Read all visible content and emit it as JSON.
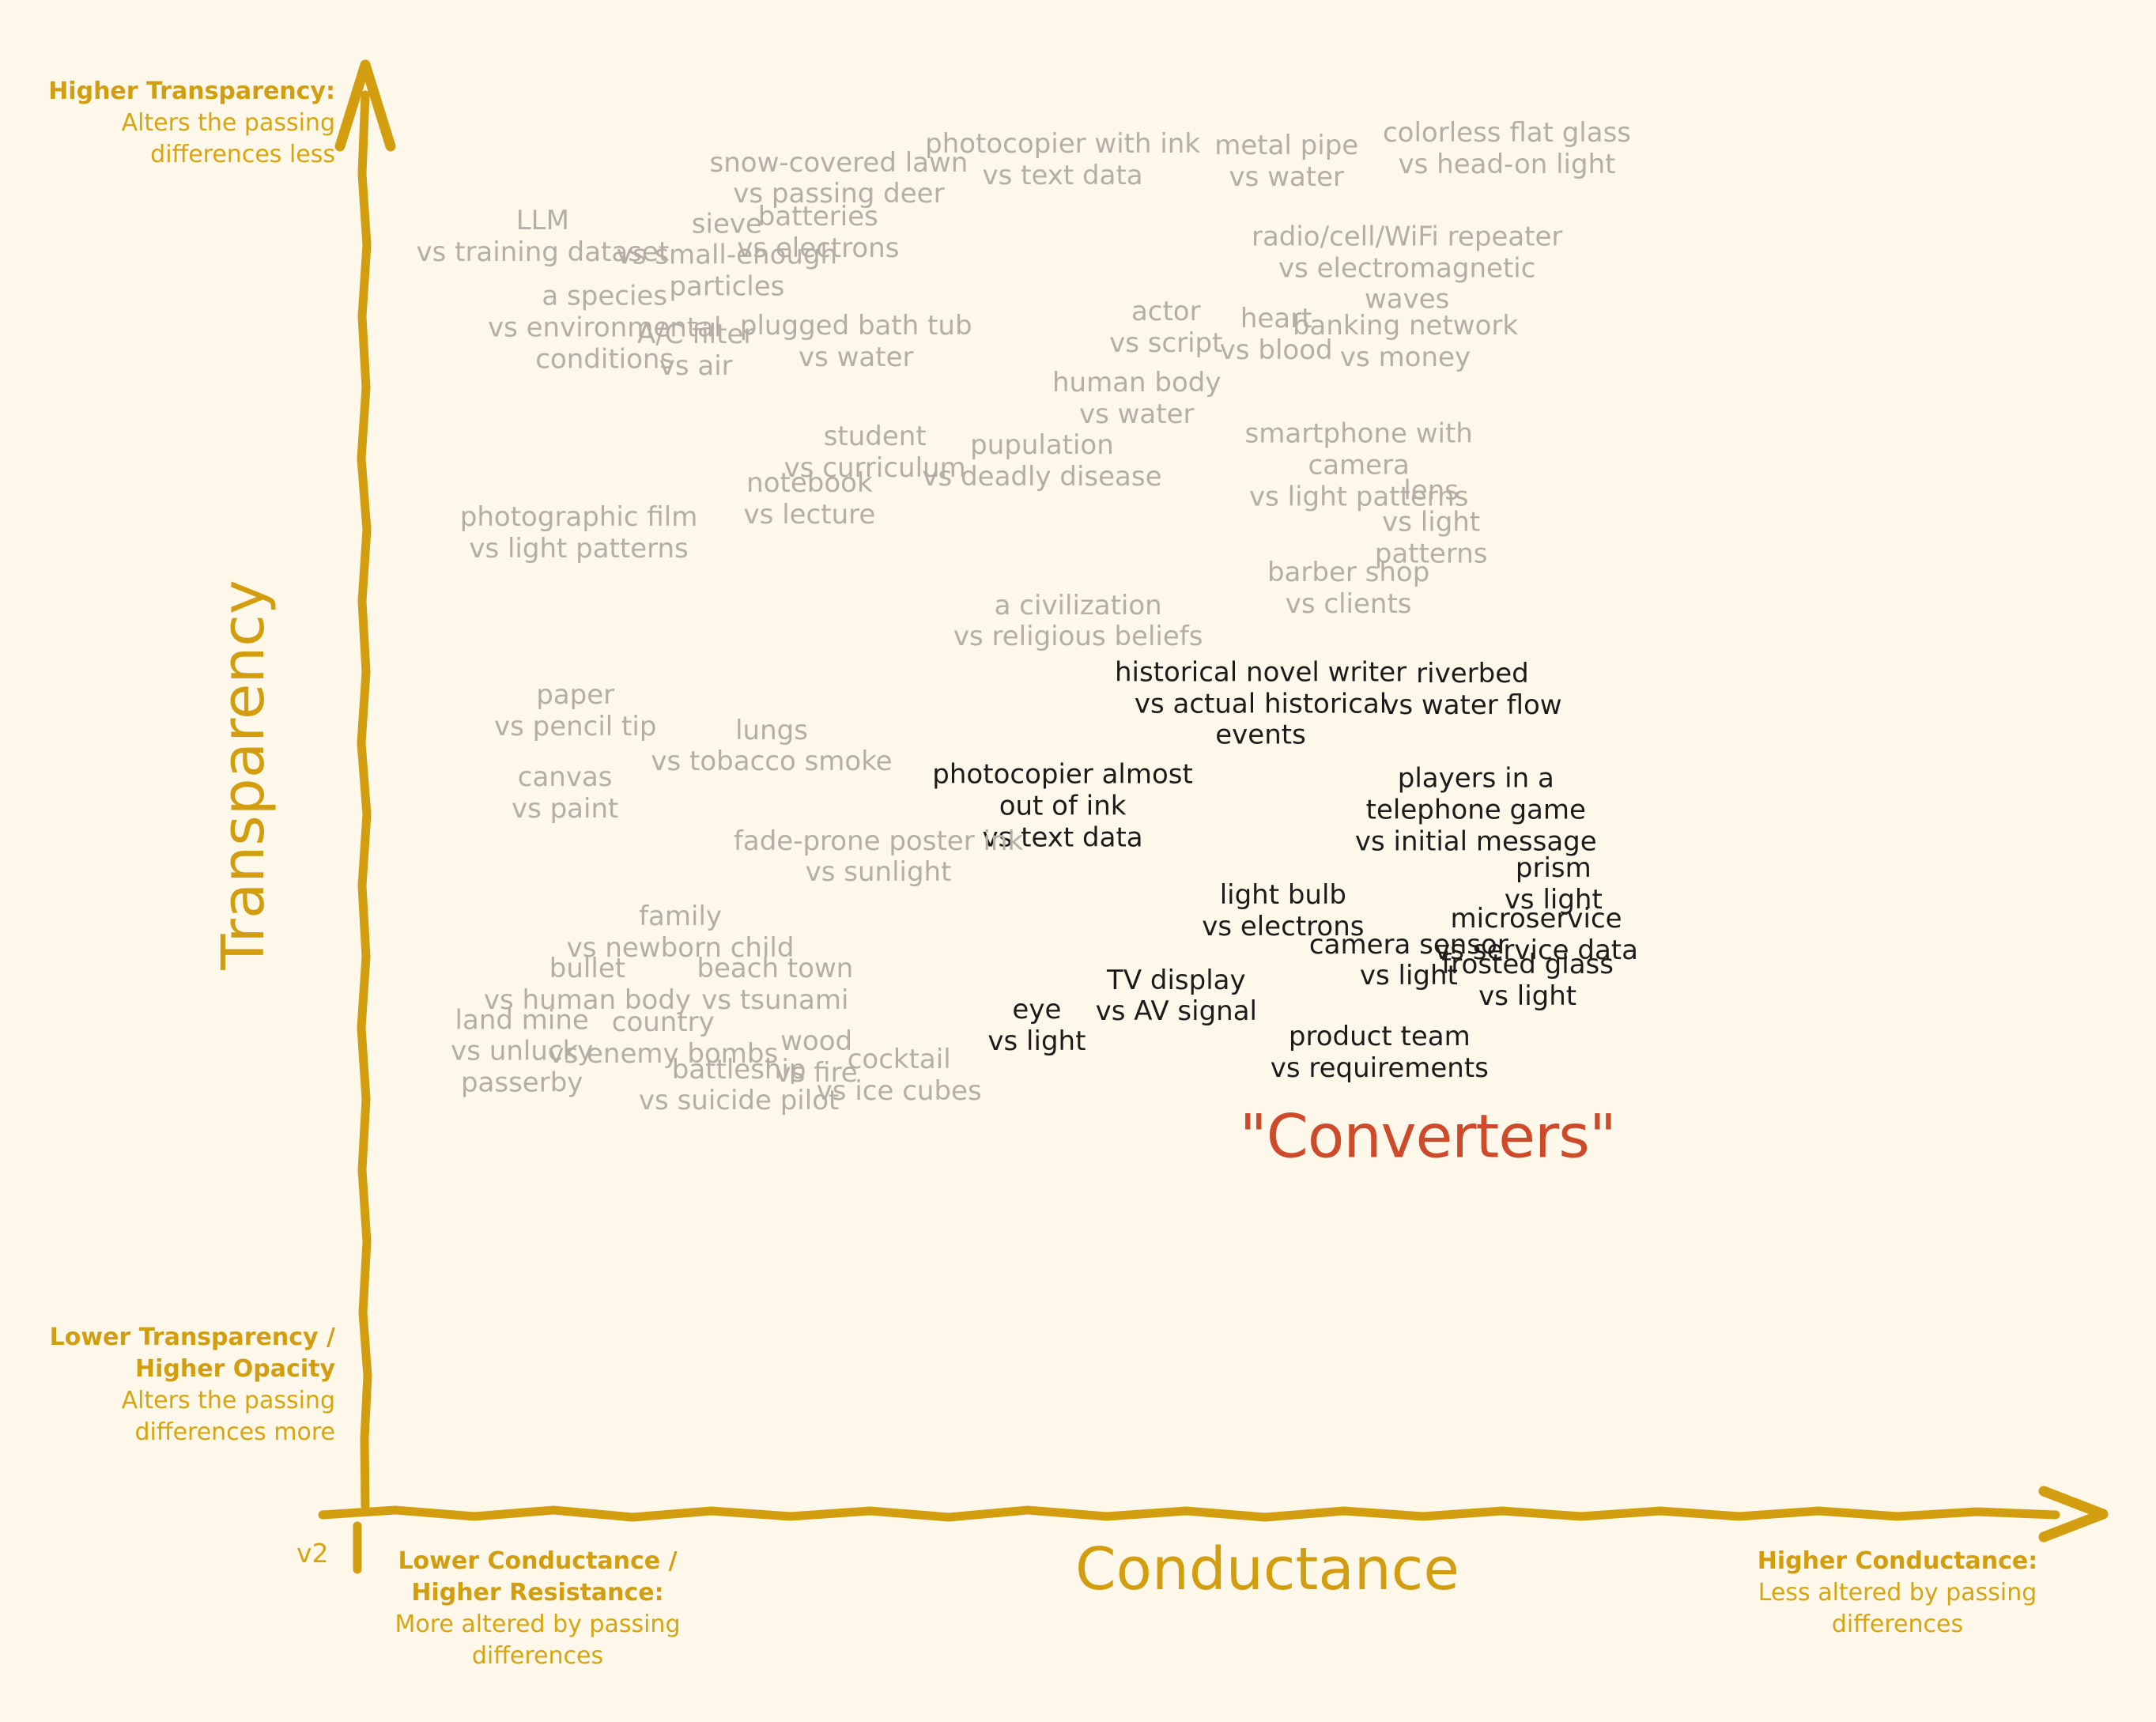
{
  "meta": {
    "version_tag": "v2",
    "background_color": "#fdf8e9",
    "axis_color": "#d39d10",
    "light_label_color": "#b4afa6",
    "dark_label_color": "#1b1b1b",
    "accent_color": "#cd4b2b"
  },
  "axes": {
    "y_title": "Transparency",
    "x_title": "Conductance",
    "top_left": {
      "heading": "Higher Transparency:",
      "subtitle": "Alters the passing\ndifferences less"
    },
    "bottom_left": {
      "heading": "Lower Transparency\n/ Higher Opacity",
      "subtitle": "Alters the passing\ndifferences more"
    },
    "x_low": {
      "heading": "Lower Conductance\n/ Higher Resistance:",
      "subtitle": "More altered by\npassing differences"
    },
    "x_high": {
      "heading": "Higher Conductance:",
      "subtitle": "Less altered by passing\ndifferences"
    }
  },
  "chart_data": {
    "type": "scatter",
    "title": "",
    "xlabel": "Conductance",
    "ylabel": "Transparency",
    "xlim": [
      0,
      100
    ],
    "ylim": [
      0,
      100
    ],
    "grid": false,
    "legend": null,
    "annotations": [
      {
        "label": "\"Converters\"",
        "x": 61.7,
        "y": 26.0,
        "style": "accent"
      }
    ],
    "points": [
      {
        "label": "snow-covered lawn\nvs passing deer",
        "x": 27.5,
        "y": 93.5,
        "style": "light"
      },
      {
        "label": "photocopier with ink\nvs text data",
        "x": 40.5,
        "y": 94.8,
        "style": "light"
      },
      {
        "label": "metal pipe\nvs water",
        "x": 53.5,
        "y": 94.7,
        "style": "light"
      },
      {
        "label": "colorless flat glass\nvs head-on light",
        "x": 66.3,
        "y": 95.6,
        "style": "light"
      },
      {
        "label": "LLM\nvs training dataset",
        "x": 10.3,
        "y": 89.4,
        "style": "light"
      },
      {
        "label": "sieve\nvs small-enough\nparticles",
        "x": 21.0,
        "y": 88.1,
        "style": "light"
      },
      {
        "label": "batteries\nvs electrons",
        "x": 26.3,
        "y": 89.7,
        "style": "light"
      },
      {
        "label": "radio/cell/WiFi repeater\nvs electromagnetic\nwaves",
        "x": 60.5,
        "y": 87.2,
        "style": "light"
      },
      {
        "label": "a species\nvs environmental\nconditions",
        "x": 13.9,
        "y": 83.0,
        "style": "light"
      },
      {
        "label": "A/C filter\nvs air",
        "x": 19.2,
        "y": 81.4,
        "style": "light"
      },
      {
        "label": "plugged bath tub\nvs water",
        "x": 28.5,
        "y": 82.0,
        "style": "light"
      },
      {
        "label": "actor\nvs script",
        "x": 46.5,
        "y": 83.0,
        "style": "light"
      },
      {
        "label": "heart\nvs blood",
        "x": 52.9,
        "y": 82.5,
        "style": "light"
      },
      {
        "label": "banking network\nvs money",
        "x": 60.4,
        "y": 82.0,
        "style": "light"
      },
      {
        "label": "human body\nvs water",
        "x": 44.8,
        "y": 78.0,
        "style": "light"
      },
      {
        "label": "student\nvs curriculum",
        "x": 29.6,
        "y": 74.2,
        "style": "light"
      },
      {
        "label": "pupulation\nvs deadly disease",
        "x": 39.3,
        "y": 73.6,
        "style": "light"
      },
      {
        "label": "smartphone with\ncamera\nvs light patterns",
        "x": 57.7,
        "y": 73.3,
        "style": "light"
      },
      {
        "label": "notebook\nvs lecture",
        "x": 25.8,
        "y": 70.9,
        "style": "light"
      },
      {
        "label": "lens\nvs light\npatterns",
        "x": 61.9,
        "y": 69.3,
        "style": "light"
      },
      {
        "label": "photographic film\nvs light patterns",
        "x": 12.4,
        "y": 68.5,
        "style": "light"
      },
      {
        "label": "barber shop\nvs clients",
        "x": 57.1,
        "y": 64.6,
        "style": "light"
      },
      {
        "label": "a civilization\nvs religious beliefs",
        "x": 41.4,
        "y": 62.3,
        "style": "light"
      },
      {
        "label": "riverbed\nvs water flow",
        "x": 64.3,
        "y": 57.5,
        "style": "dark"
      },
      {
        "label": "historical novel writer\nvs actual historical\nevents",
        "x": 52.0,
        "y": 56.5,
        "style": "dark"
      },
      {
        "label": "paper\nvs pencil tip",
        "x": 12.2,
        "y": 56.0,
        "style": "light"
      },
      {
        "label": "lungs\nvs tobacco smoke",
        "x": 23.6,
        "y": 53.5,
        "style": "light"
      },
      {
        "label": "photocopier almost\nout of ink\nvs text data",
        "x": 40.5,
        "y": 49.3,
        "style": "dark"
      },
      {
        "label": "players in a\ntelephone game\nvs initial message",
        "x": 64.5,
        "y": 49.0,
        "style": "dark"
      },
      {
        "label": "canvas\nvs paint",
        "x": 11.6,
        "y": 50.2,
        "style": "light"
      },
      {
        "label": "fade-prone poster ink\nvs sunlight",
        "x": 29.8,
        "y": 45.7,
        "style": "light"
      },
      {
        "label": "prism\nvs light",
        "x": 69.0,
        "y": 43.8,
        "style": "dark"
      },
      {
        "label": "light bulb\nvs electrons",
        "x": 53.3,
        "y": 41.9,
        "style": "dark"
      },
      {
        "label": "microservice\nvs service data",
        "x": 68.0,
        "y": 40.2,
        "style": "dark"
      },
      {
        "label": "family\nvs newborn child",
        "x": 18.3,
        "y": 40.4,
        "style": "light"
      },
      {
        "label": "camera sensor\nvs light",
        "x": 60.6,
        "y": 38.4,
        "style": "dark"
      },
      {
        "label": "frosted glass\nvs light",
        "x": 67.5,
        "y": 37.0,
        "style": "dark"
      },
      {
        "label": "bullet\nvs human body",
        "x": 12.9,
        "y": 36.7,
        "style": "light"
      },
      {
        "label": "beach town\nvs tsunami",
        "x": 23.8,
        "y": 36.7,
        "style": "light"
      },
      {
        "label": "TV display\nvs AV signal",
        "x": 47.1,
        "y": 35.9,
        "style": "dark"
      },
      {
        "label": "eye\nvs light",
        "x": 39.0,
        "y": 33.8,
        "style": "dark"
      },
      {
        "label": "land mine\nvs unlucky\npasserby",
        "x": 9.1,
        "y": 32.0,
        "style": "light"
      },
      {
        "label": "country\nvs enemy bombs",
        "x": 17.3,
        "y": 32.9,
        "style": "light"
      },
      {
        "label": "wood\nvs fire",
        "x": 26.2,
        "y": 31.6,
        "style": "light"
      },
      {
        "label": "cocktail\nvs ice cubes",
        "x": 31.0,
        "y": 30.3,
        "style": "light"
      },
      {
        "label": "product team\nvs requirements",
        "x": 58.9,
        "y": 31.9,
        "style": "dark"
      },
      {
        "label": "battleship\nvs suicide pilot",
        "x": 21.7,
        "y": 29.6,
        "style": "light"
      }
    ]
  }
}
